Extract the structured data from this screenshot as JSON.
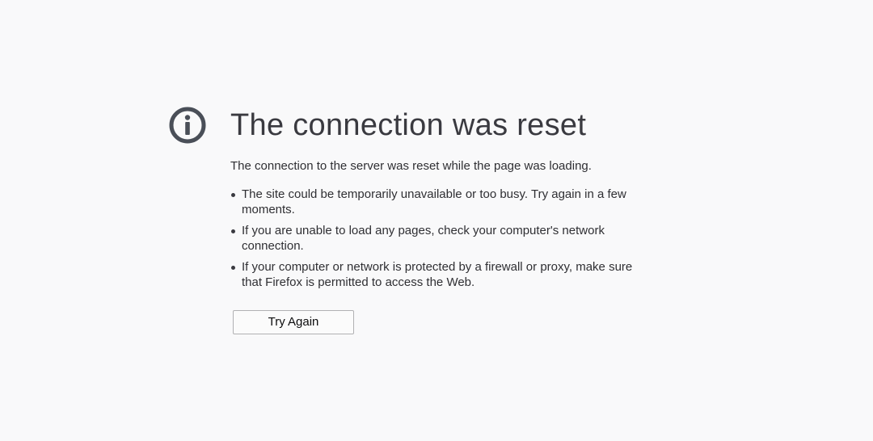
{
  "error": {
    "icon": "info-icon",
    "title": "The connection was reset",
    "short_description": "The connection to the server was reset while the page was loading.",
    "reasons": [
      "The site could be temporarily unavailable or too busy. Try again in a few moments.",
      "If you are unable to load any pages, check your computer's network connection.",
      "If your computer or network is protected by a firewall or proxy, make sure that Firefox is permitted to access the Web."
    ],
    "try_again_label": "Try Again"
  },
  "colors": {
    "background": "#f9f9fa",
    "icon": "#4a4f58",
    "title": "#3a3a40",
    "text": "#2f2f33",
    "button_border": "#b1b1b3"
  }
}
